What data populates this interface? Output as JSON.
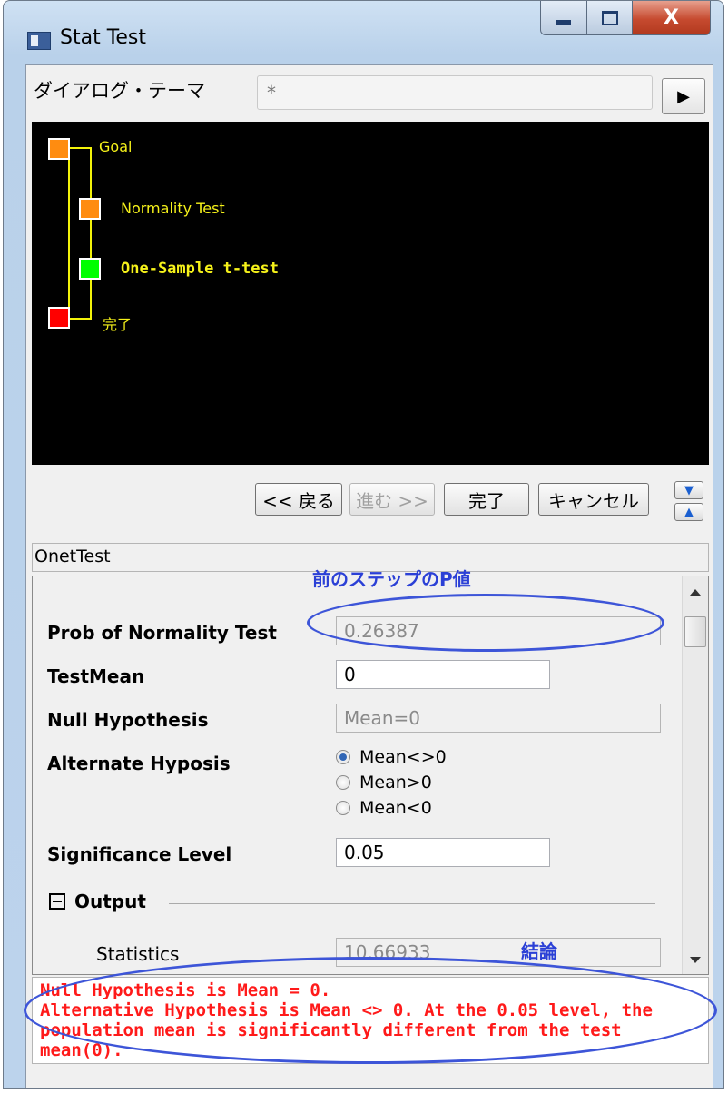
{
  "window": {
    "title": "Stat Test",
    "close_glyph": "X"
  },
  "theme": {
    "label": "ダイアログ・テーマ",
    "value": "*",
    "menu_glyph": "▶"
  },
  "tree": {
    "nodes": [
      {
        "label": "Goal",
        "color": "#ff8c10"
      },
      {
        "label": "Normality Test",
        "color": "#ff8c10"
      },
      {
        "label": "One-Sample t-test",
        "color": "#00ff00",
        "active": true
      },
      {
        "label": "完了",
        "color": "#ff0000"
      }
    ]
  },
  "wizard": {
    "back": "<< 戻る",
    "next": "進む >>",
    "finish": "完了",
    "cancel": "キャンセル"
  },
  "name_field": "OnetTest",
  "params": {
    "prob_label": "Prob of Normality Test",
    "prob_value": "0.26387",
    "testmean_label": "TestMean",
    "testmean_value": "0",
    "null_label": "Null Hypothesis",
    "null_value": "Mean=0",
    "alt_label": "Alternate Hyposis",
    "alt_options": [
      "Mean<>0",
      "Mean>0",
      "Mean<0"
    ],
    "alt_selected": 0,
    "sig_label": "Significance Level",
    "sig_value": "0.05",
    "output_label": "Output",
    "statistics_label": "Statistics",
    "statistics_value": "10.66933"
  },
  "result_lines": [
    "Null Hypothesis is Mean = 0.",
    "Alternative Hypothesis is Mean <> 0. At the 0.05 level, the",
    "population mean is significantly different from the test",
    "mean(0)."
  ],
  "annotations": {
    "pvalue": "前のステップのP値",
    "conclusion": "結論",
    "color": "#2b40d6"
  }
}
